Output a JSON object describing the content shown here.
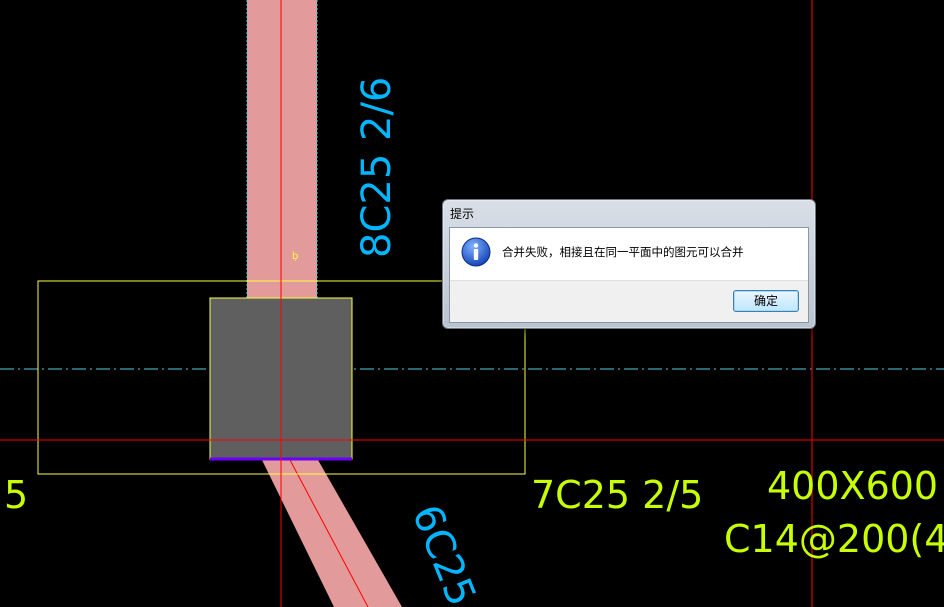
{
  "drawing": {
    "label_rebar_vertical": "8C25 2/6",
    "label_rebar_right": "7C25 2/5",
    "label_rebar_diagonal": "6C25",
    "label_left_partial": "5",
    "label_section": "400X600",
    "label_stirrup": "C14@200(4",
    "small_mark": "ḅ"
  },
  "dialog": {
    "title": "提示",
    "message": "合并失败，相接且在同一平面中的图元可以合并",
    "ok_label": "确定",
    "icon": "info-icon"
  },
  "colors": {
    "background": "#000000",
    "beam_fill": "#e39a9a",
    "column_fill": "#5f5f5f",
    "axis_red": "#ff0000",
    "outline_yellow": "#ffff44",
    "dimension_cyan": "#00b7ff",
    "annotation_green": "#c8ff00",
    "column_base_purple": "#6a00ff",
    "centerline_cyan": "#4fd0e0"
  }
}
